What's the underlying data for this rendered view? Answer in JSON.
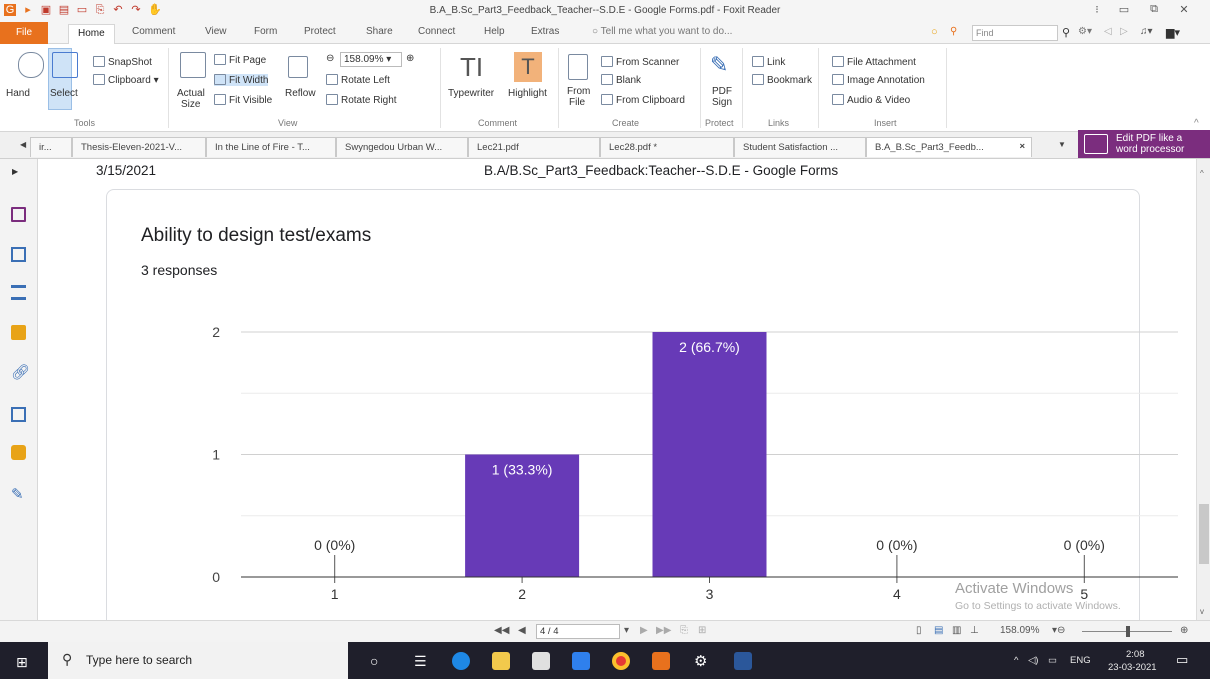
{
  "window": {
    "title": "B.A_B.Sc_Part3_Feedback_Teacher--S.D.E - Google Forms.pdf - Foxit Reader"
  },
  "ribbon_tabs": [
    "File",
    "Home",
    "Comment",
    "View",
    "Form",
    "Protect",
    "Share",
    "Connect",
    "Help",
    "Extras"
  ],
  "tell_me": "Tell me what you want to do...",
  "find_placeholder": "Find",
  "ribbon": {
    "tools": {
      "hand": "Hand",
      "select": "Select",
      "snapshot": "SnapShot",
      "clipboard": "Clipboard",
      "group": "Tools"
    },
    "view": {
      "actual_size_1": "Actual",
      "actual_size_2": "Size",
      "fit_page": "Fit Page",
      "fit_width": "Fit Width",
      "fit_visible": "Fit Visible",
      "reflow": "Reflow",
      "zoom": "158.09%",
      "rotate_left": "Rotate Left",
      "rotate_right": "Rotate Right",
      "group": "View"
    },
    "comment": {
      "typewriter": "Typewriter",
      "highlight": "Highlight",
      "group": "Comment"
    },
    "create": {
      "from_file_1": "From",
      "from_file_2": "File",
      "from_scanner": "From Scanner",
      "blank": "Blank",
      "from_clipboard": "From Clipboard",
      "group": "Create"
    },
    "protect": {
      "pdf_sign_1": "PDF",
      "pdf_sign_2": "Sign",
      "group": "Protect"
    },
    "links": {
      "link": "Link",
      "bookmark": "Bookmark",
      "group": "Links"
    },
    "insert": {
      "file_attachment": "File Attachment",
      "image_annotation": "Image Annotation",
      "audio_video": "Audio & Video",
      "group": "Insert"
    }
  },
  "doc_tabs": [
    "ir...",
    "Thesis-Eleven-2021-V...",
    "In the Line of Fire - T...",
    "Swyngedou Urban W...",
    "Lec21.pdf",
    "Lec28.pdf *",
    "Student Satisfaction ...",
    "B.A_B.Sc_Part3_Feedb..."
  ],
  "promo": {
    "line1": "Edit PDF like a",
    "line2": "word processor"
  },
  "page_header": {
    "date": "3/15/2021",
    "title": "B.A/B.Sc_Part3_Feedback:Teacher--S.D.E - Google Forms"
  },
  "question": {
    "title": "Ability to design test/exams",
    "responses": "3 responses"
  },
  "chart_data": {
    "type": "bar",
    "categories": [
      "1",
      "2",
      "3",
      "4",
      "5"
    ],
    "values": [
      0,
      1,
      2,
      0,
      0
    ],
    "data_labels": [
      "0 (0%)",
      "1 (33.3%)",
      "2 (66.7%)",
      "0 (0%)",
      "0 (0%)"
    ],
    "ylim": [
      0,
      2
    ],
    "yticks": [
      "0",
      "1",
      "2"
    ],
    "bar_color": "#673ab7",
    "grid": true
  },
  "watermark": {
    "line1": "Activate Windows",
    "line2": "Go to Settings to activate Windows."
  },
  "status": {
    "page": "4 / 4",
    "zoom": "158.09%"
  },
  "taskbar": {
    "search": "Type here to search",
    "lang": "ENG",
    "time": "2:08",
    "date": "23-03-2021"
  }
}
